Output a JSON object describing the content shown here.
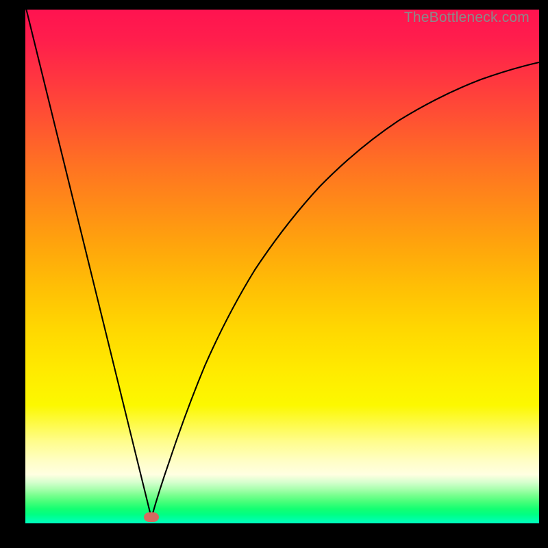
{
  "watermark": "TheBottleneck.com",
  "chart_data": {
    "type": "line",
    "title": "",
    "xlabel": "",
    "ylabel": "",
    "xlim": [
      0,
      100
    ],
    "ylim": [
      0,
      100
    ],
    "grid": false,
    "legend": false,
    "series": [
      {
        "name": "curve",
        "x": [
          0,
          5,
          10,
          15,
          20,
          23,
          24.5,
          26,
          28,
          30,
          32,
          35,
          38,
          42,
          46,
          50,
          55,
          60,
          65,
          70,
          75,
          80,
          85,
          90,
          95,
          100
        ],
        "y": [
          100,
          80.3,
          60.0,
          39.7,
          19.3,
          7.1,
          1.0,
          1.4,
          5.5,
          12.0,
          19.0,
          28.5,
          36.8,
          46.0,
          53.6,
          59.8,
          66.1,
          71.0,
          75.0,
          78.2,
          80.8,
          83.0,
          84.8,
          86.3,
          87.5,
          88.5
        ]
      }
    ],
    "marker": {
      "x": 24.5,
      "y": 1.0,
      "color": "#d46a60"
    },
    "background_gradient": {
      "type": "vertical",
      "stops": [
        {
          "pos": 0.0,
          "color": "#ff1350"
        },
        {
          "pos": 0.5,
          "color": "#ffb008"
        },
        {
          "pos": 0.78,
          "color": "#fff700"
        },
        {
          "pos": 0.9,
          "color": "#ffffe1"
        },
        {
          "pos": 1.0,
          "color": "#00ffb0"
        }
      ]
    }
  }
}
